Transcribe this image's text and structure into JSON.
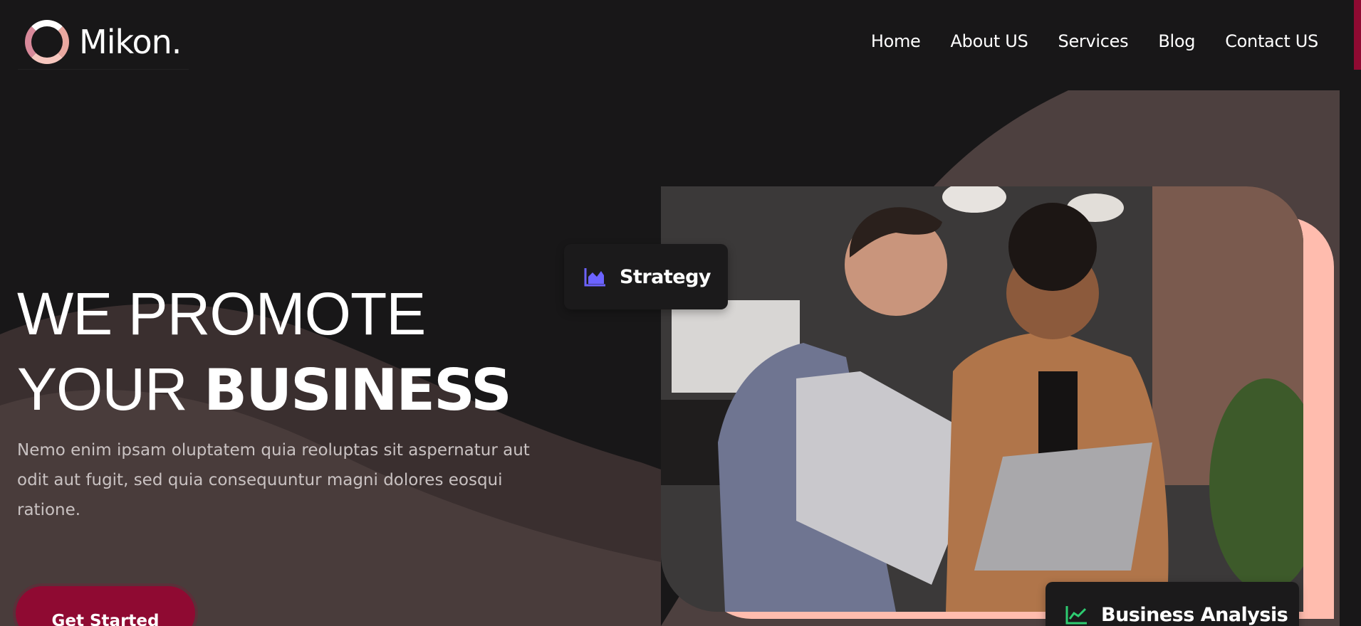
{
  "brand": {
    "name": "Mikon.",
    "accent_color": "#8f0a32",
    "highlight_color": "#ffbcae"
  },
  "nav": {
    "items": [
      {
        "label": "Home"
      },
      {
        "label": "About US"
      },
      {
        "label": "Services"
      },
      {
        "label": "Blog"
      },
      {
        "label": "Contact US"
      }
    ]
  },
  "hero": {
    "line1": "WE PROMOTE",
    "line2_light": "YOUR",
    "line2_bold": "BUSINESS",
    "description": "Nemo enim ipsam oluptatem quia reoluptas sit aspernatur aut odit aut fugit, sed quia consequuntur magni dolores eosqui ratione.",
    "cta_label": "Get Started"
  },
  "cards": {
    "strategy": {
      "label": "Strategy",
      "icon": "area-chart-icon",
      "icon_color": "#6c63ff"
    },
    "analysis": {
      "label": "Business Analysis",
      "icon": "line-chart-icon",
      "icon_color": "#2ecc71"
    }
  }
}
